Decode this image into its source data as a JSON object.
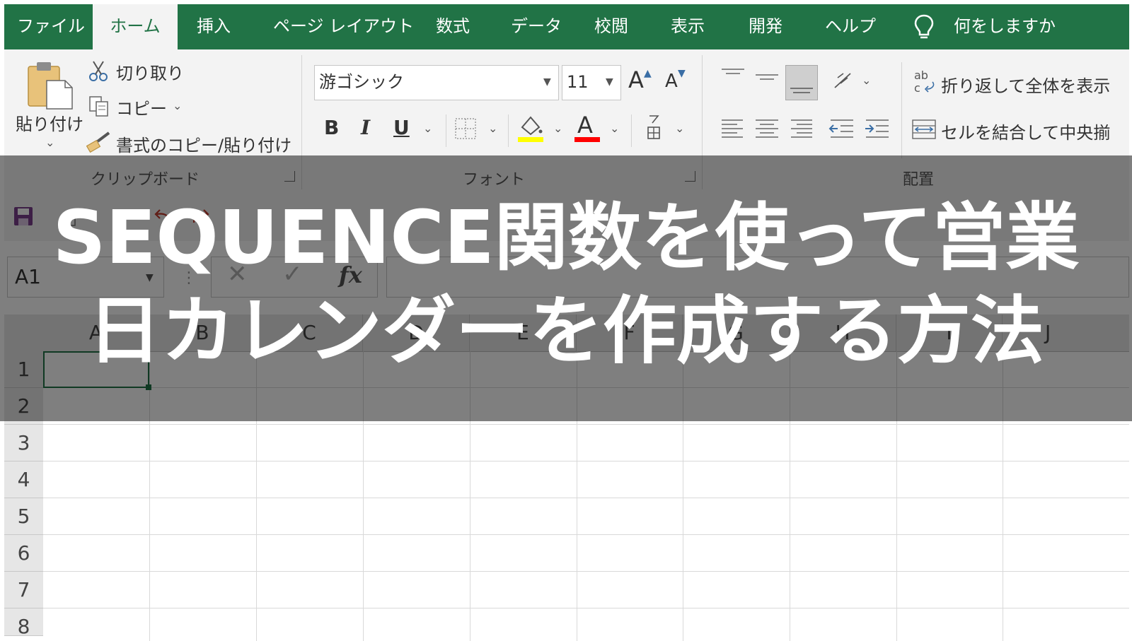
{
  "ribbon": {
    "tabs": [
      {
        "label": "ファイル"
      },
      {
        "label": "ホーム"
      },
      {
        "label": "挿入"
      },
      {
        "label": "ページ レイアウト"
      },
      {
        "label": "数式"
      },
      {
        "label": "データ"
      },
      {
        "label": "校閲"
      },
      {
        "label": "表示"
      },
      {
        "label": "開発"
      },
      {
        "label": "ヘルプ"
      }
    ],
    "active_tab": "ホーム",
    "tell_me": "何をしますか",
    "clipboard": {
      "paste": "貼り付け",
      "cut": "切り取り",
      "copy": "コピー",
      "format_painter": "書式のコピー/貼り付け",
      "group_label": "クリップボード"
    },
    "font": {
      "name": "游ゴシック",
      "size": "11",
      "bold": "B",
      "italic": "I",
      "underline": "U",
      "font_color_letter": "A",
      "grow_letter": "A",
      "shrink_letter": "A",
      "group_label": "フォント",
      "fill_color": "#ffff00",
      "text_color": "#ff0000"
    },
    "alignment": {
      "wrap_text": "折り返して全体を表示",
      "merge_center": "セルを結合して中央揃",
      "group_label": "配置"
    }
  },
  "formula_bar": {
    "name_box": "A1",
    "fx": "fx"
  },
  "sheet": {
    "columns": [
      "A",
      "B",
      "C",
      "D",
      "E",
      "F",
      "G",
      "H",
      "I",
      "J"
    ],
    "rows": [
      "1",
      "2",
      "3",
      "4",
      "5",
      "6",
      "7",
      "8"
    ]
  },
  "overlay": {
    "title_line1": "SEQUENCE関数を使って営業",
    "title_line2": "日カレンダーを作成する方法"
  },
  "colors": {
    "excel_green": "#217346",
    "ribbon_bg": "#f3f3f3"
  }
}
